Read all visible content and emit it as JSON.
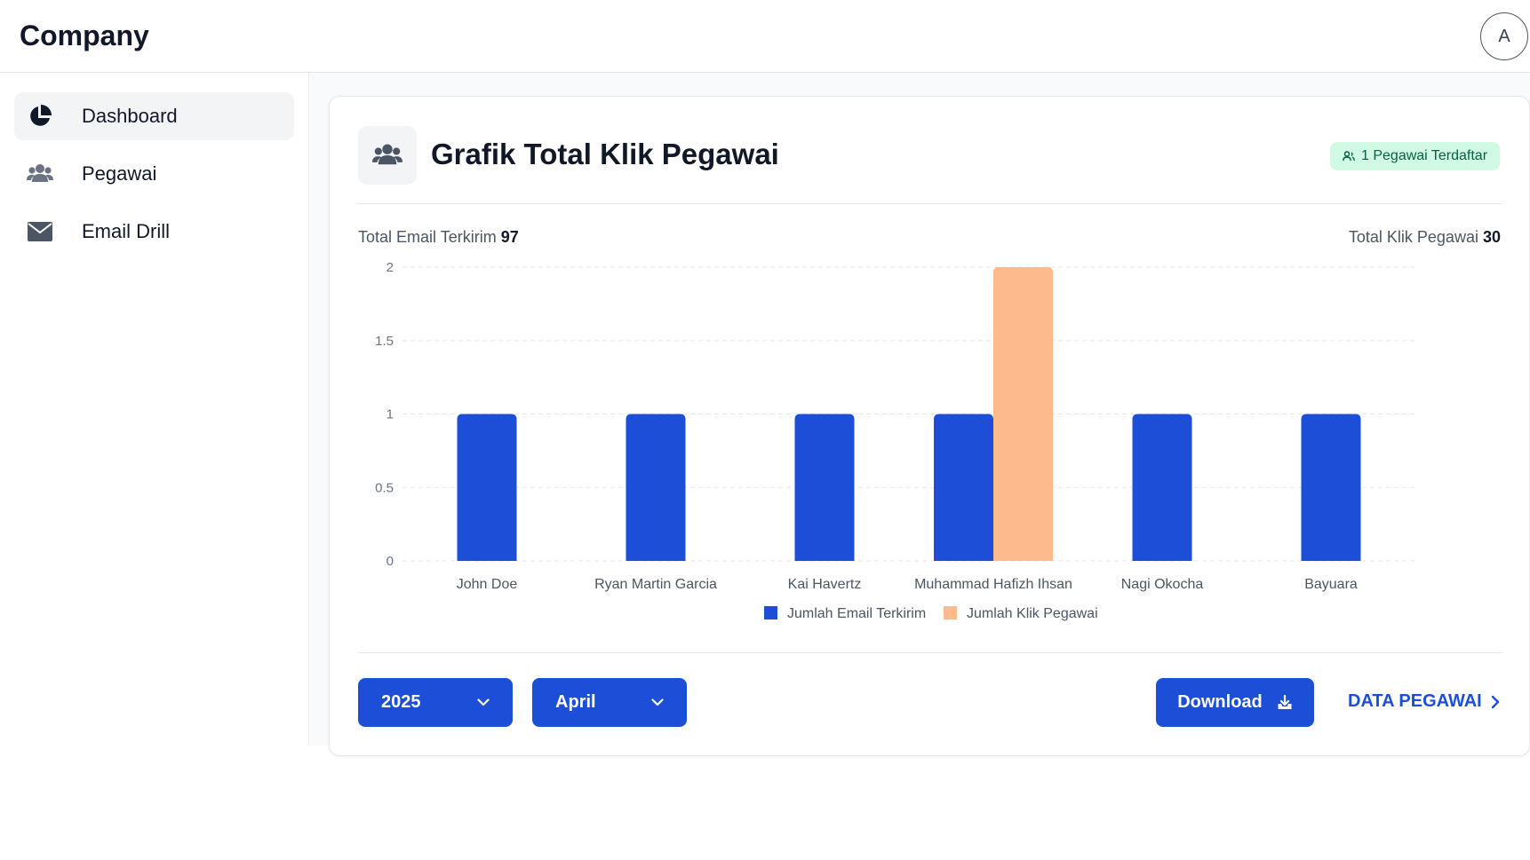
{
  "header": {
    "brand": "Company",
    "avatar_initial": "A"
  },
  "sidebar": {
    "items": [
      {
        "label": "Dashboard",
        "icon": "pie-chart-icon",
        "active": true
      },
      {
        "label": "Pegawai",
        "icon": "users-icon",
        "active": false
      },
      {
        "label": "Email Drill",
        "icon": "mail-icon",
        "active": false
      }
    ]
  },
  "card": {
    "title": "Grafik Total Klik Pegawai",
    "badge": "1 Pegawai Terdaftar",
    "total_email_label": "Total Email Terkirim",
    "total_email_value": "97",
    "total_klik_label": "Total Klik Pegawai",
    "total_klik_value": "30"
  },
  "controls": {
    "year": "2025",
    "month": "April",
    "download_label": "Download",
    "data_link_label": "DATA PEGAWAI"
  },
  "colors": {
    "primary": "#1d4ed8",
    "secondary": "#fdba8c",
    "badge_bg": "#d1fae5",
    "badge_text": "#065f46"
  },
  "chart_data": {
    "type": "bar",
    "categories": [
      "John Doe",
      "Ryan Martin Garcia",
      "Kai Havertz",
      "Muhammad Hafizh Ihsan",
      "Nagi Okocha",
      "Bayuara"
    ],
    "series": [
      {
        "name": "Jumlah Email Terkirim",
        "values": [
          1,
          1,
          1,
          1,
          1,
          1
        ],
        "color": "#1d4ed8"
      },
      {
        "name": "Jumlah Klik Pegawai",
        "values": [
          0,
          0,
          0,
          2,
          0,
          0
        ],
        "color": "#fdba8c"
      }
    ],
    "ylim": [
      0,
      2
    ],
    "yticks": [
      "0",
      "0.5",
      "1",
      "1.5",
      "2"
    ],
    "grid": true,
    "legend": "bottom-center"
  }
}
